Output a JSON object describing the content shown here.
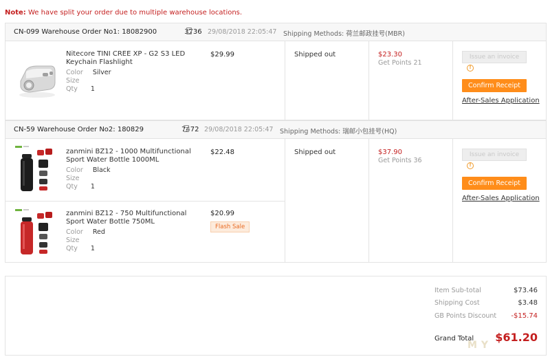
{
  "note": {
    "label": "Note:",
    "text": "We have split your order due to multiple warehouse locations."
  },
  "orders": [
    {
      "id_prefix": "CN-099 Warehouse Order No1: 18082900",
      "id_suffix": "3736",
      "date": "29/08/2018 22:05:47",
      "shipping": "Shipping Methods: 荷兰邮政挂号(MBR)",
      "status": "Shipped out",
      "paid": "$23.30",
      "points": "Get Points 21",
      "invoice_label": "Issue an invoice",
      "confirm_label": "Confirm Receipt",
      "aftersales_label": "After-Sales Application",
      "items": [
        {
          "name": "Nitecore TINI CREE XP - G2 S3 LED Keychain Flashlight",
          "price": "$29.99",
          "color_label": "Color",
          "color": "Silver",
          "size_label": "Size",
          "size": "",
          "qty_label": "Qty",
          "qty": "1"
        }
      ]
    },
    {
      "id_prefix": "CN-59 Warehouse Order No2: 180829",
      "id_suffix": "7472",
      "date": "29/08/2018 22:05:47",
      "shipping": "Shipping Methods: 瑞邮小包挂号(HQ)",
      "status": "Shipped out",
      "paid": "$37.90",
      "points": "Get Points 36",
      "invoice_label": "Issue an invoice",
      "confirm_label": "Confirm Receipt",
      "aftersales_label": "After-Sales Application",
      "items": [
        {
          "name": "zanmini BZ12 - 1000 Multifunctional Sport Water Bottle 1000ML",
          "price": "$22.48",
          "color_label": "Color",
          "color": "Black",
          "size_label": "Size",
          "size": "",
          "qty_label": "Qty",
          "qty": "1"
        },
        {
          "name": "zanmini BZ12 - 750 Multifunctional Sport Water Bottle 750ML",
          "price": "$20.99",
          "badge": "Flash Sale",
          "color_label": "Color",
          "color": "Red",
          "size_label": "Size",
          "size": "",
          "qty_label": "Qty",
          "qty": "1"
        }
      ]
    }
  ],
  "summary": {
    "subtotal_label": "Item Sub-total",
    "subtotal": "$73.46",
    "shipping_label": "Shipping Cost",
    "shipping": "$3.48",
    "discount_label": "GB Points Discount",
    "discount": "-$15.74",
    "total_label": "Grand Total",
    "total": "$61.20"
  },
  "watermark": "MY",
  "colors": {
    "accent": "#ff8d1a",
    "price_red": "#c41f1f",
    "muted": "#999999"
  }
}
